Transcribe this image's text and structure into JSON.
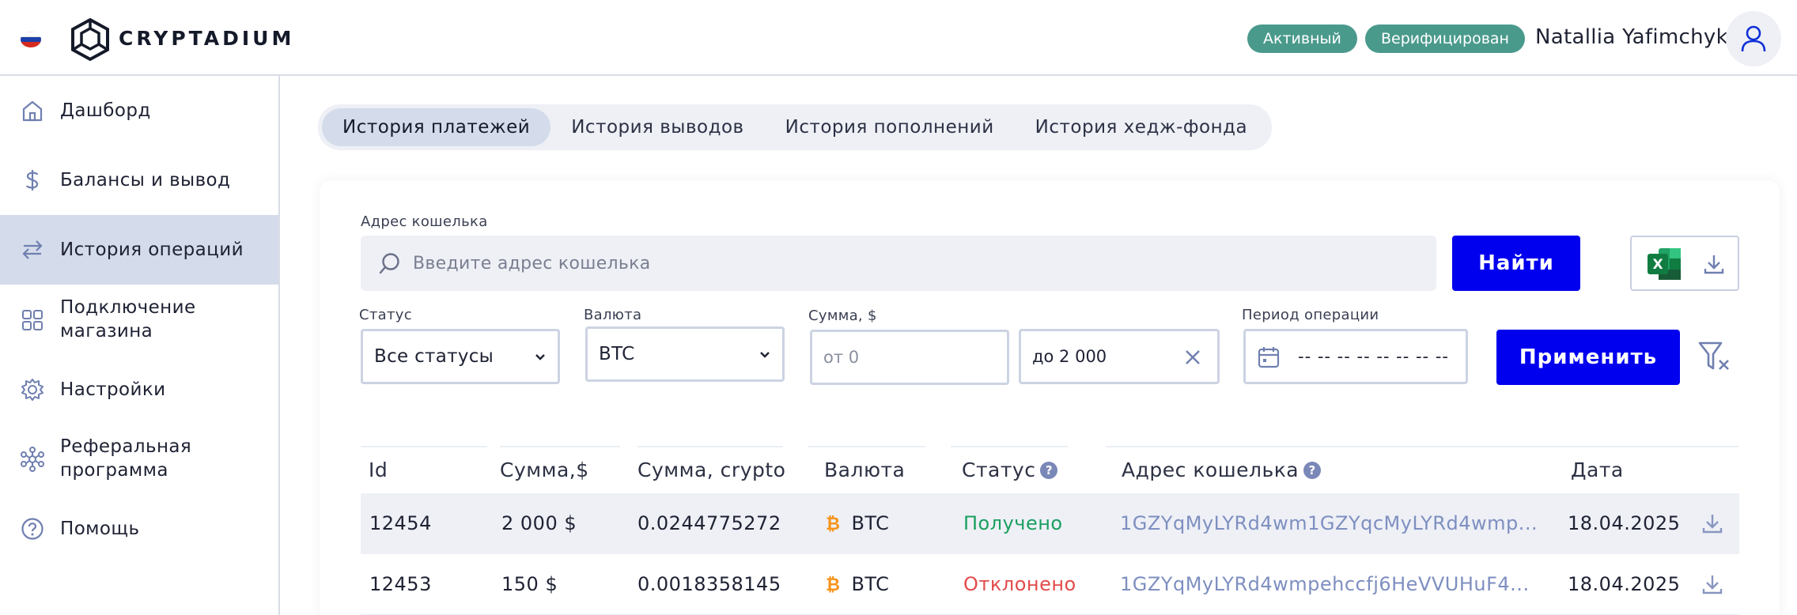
{
  "header": {
    "brand": "CRYPTADIUM",
    "badges": {
      "active": "Активный",
      "verified": "Верифицирован"
    },
    "user_name": "Natallia Yafimchyk",
    "colors": {
      "badge": "#4a9a8c",
      "accent": "#0000ee"
    }
  },
  "sidebar": {
    "items": [
      {
        "label": "Дашборд",
        "icon": "home-icon"
      },
      {
        "label": "Балансы и вывод",
        "icon": "dollar-icon"
      },
      {
        "label": "История операций",
        "icon": "transfer-arrows-icon",
        "selected": true
      },
      {
        "label": "Подключение магазина",
        "icon": "grid-icon"
      },
      {
        "label": "Настройки",
        "icon": "gear-icon"
      },
      {
        "label": "Реферальная программа",
        "icon": "network-icon"
      },
      {
        "label": "Помощь",
        "icon": "help-circle-icon"
      }
    ]
  },
  "tabs": [
    {
      "label": "История платежей",
      "selected": true
    },
    {
      "label": "История выводов"
    },
    {
      "label": "История пополнений"
    },
    {
      "label": "История хедж-фонда"
    }
  ],
  "filters": {
    "wallet_label": "Адрес кошелька",
    "wallet_placeholder": "Введите адрес кошелька",
    "find_label": "Найти",
    "status_label": "Статус",
    "status_value": "Все статусы",
    "currency_label": "Валюта",
    "currency_value": "BTC",
    "amount_label": "Сумма, $",
    "amount_from_placeholder": "от 0",
    "amount_to_value": "до 2 000",
    "period_label": "Период операции",
    "period_value": "-- -- -- -- -- -- -- --",
    "apply_label": "Применить"
  },
  "table": {
    "columns": [
      "Id",
      "Сумма,$",
      "Сумма, crypto",
      "Валюта",
      "Статус",
      "Адрес кошелька",
      "Дата"
    ],
    "rows": [
      {
        "id": "12454",
        "amount_usd": "2 000 $",
        "amount_crypto": "0.0244775272",
        "currency": "BTC",
        "status": "Получено",
        "address": "1GZYqMyLYRd4wm1GZYqcMyLYRd4wmp...",
        "date": "18.04.2025"
      },
      {
        "id": "12453",
        "amount_usd": "150 $",
        "amount_crypto": "0.0018358145",
        "currency": "BTC",
        "status": "Отклонено",
        "address": "1GZYqMyLYRd4wmpehccfj6HeVVUHuF4...",
        "date": "18.04.2025"
      }
    ],
    "colors": {
      "received": "#1a9f5f",
      "rejected": "#e34b4b",
      "address": "#7e8fc0"
    }
  }
}
